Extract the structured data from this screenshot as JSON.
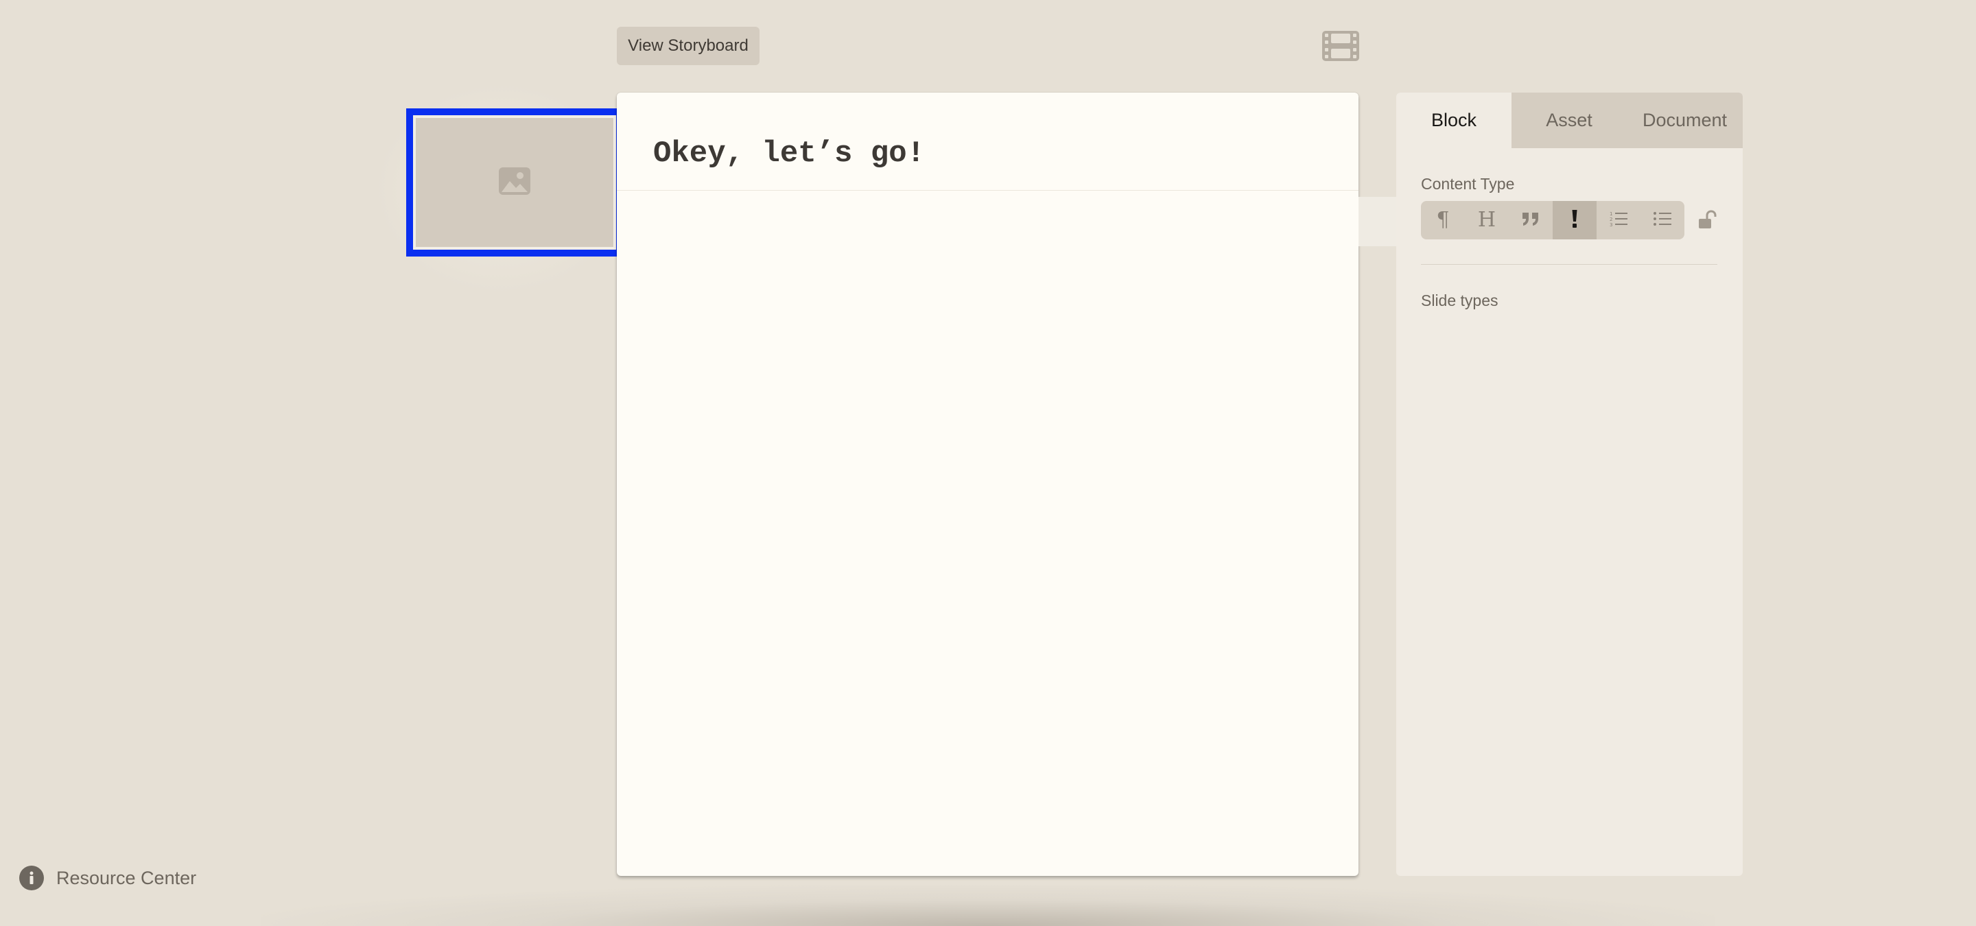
{
  "toolbar": {
    "storyboard_label": "View Storyboard",
    "film_icon": "film-strip-icon"
  },
  "thumbnail": {
    "icon": "image-placeholder-icon",
    "selected_border_color": "#0a2ff0"
  },
  "card": {
    "title": "Okey, let’s go!"
  },
  "panel": {
    "tabs": [
      {
        "label": "Block",
        "active": true
      },
      {
        "label": "Asset",
        "active": false
      },
      {
        "label": "Document",
        "active": false
      }
    ],
    "content_type_label": "Content Type",
    "content_types": [
      {
        "name": "paragraph",
        "glyph": "¶",
        "active": false
      },
      {
        "name": "heading",
        "glyph": "H",
        "active": false
      },
      {
        "name": "quote",
        "glyph": "quote-icon",
        "active": false
      },
      {
        "name": "emphasis",
        "glyph": "!",
        "active": true
      },
      {
        "name": "ordered-list",
        "glyph": "ordered-list-icon",
        "active": false
      },
      {
        "name": "bullet-list",
        "glyph": "bullet-list-icon",
        "active": false
      }
    ],
    "lock_icon": "unlocked-padlock-icon",
    "slide_types_label": "Slide types"
  },
  "footer": {
    "resource_center_label": "Resource Center",
    "info_icon": "info-icon"
  }
}
